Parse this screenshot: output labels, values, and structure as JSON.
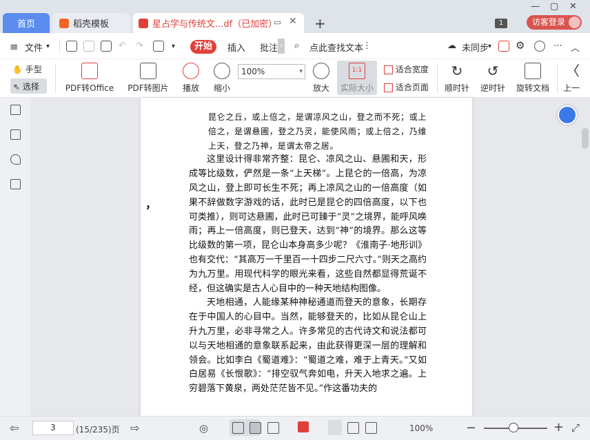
{
  "tabs": {
    "home": "首页",
    "template": "稻壳模板",
    "document": "星占学与传统文...df（已加密）"
  },
  "titlebar": {
    "page_badge": "1",
    "login": "访客登录"
  },
  "menu": {
    "file": "文件",
    "start": "开始",
    "insert": "插入",
    "annotate": "批注",
    "find_text": "点此查找文本",
    "sync": "未同步"
  },
  "ribbon": {
    "hand": "手型",
    "select": "选择",
    "pdf_to_office": "PDF转Office",
    "pdf_to_image": "PDF转图片",
    "play": "播放",
    "zoom_out": "缩小",
    "zoom_value": "100%",
    "zoom_in": "放大",
    "actual_size": "实际大小",
    "fit_width": "适合宽度",
    "fit_page": "适合页面",
    "rotate_cw": "顺时针",
    "rotate_ccw": "逆时针",
    "rotate_doc": "旋转文档",
    "prev": "上一"
  },
  "document": {
    "quote": "昆仑之丘，或上倍之，是谓凉风之山，登之而不死；或上倍之，是谓悬圃，登之乃灵，能使风雨；或上倍之，乃维上天，登之乃神，是谓太帝之居。",
    "paragraph1": "这里设计得非常齐整：昆仑、凉风之山、悬圃和天，形成等比级数，俨然是一条“上天梯”。上昆仑的一倍高，为凉风之山，登上即可长生不死；再上凉风之山的一倍高度（如果不辞做数字游戏的话，此时已是昆仑的四倍高度，以下也可类推），则可达悬圃，此时已可臻于“灵”之境界，能呼风唤雨；再上一倍高度，则已登天，达到“神”的境界。那么这等比级数的第一项，昆仑山本身高多少呢？《淮南子·地形训》也有交代：“其高万一千里百一十四步二尺六寸。”则天之高约为九万里。用现代科学的眼光来看，这些自然都显得荒诞不经，但这确实是古人心目中的一种天地结构图像。",
    "paragraph2": "天地相通，人能缘某种神秘通道而登天的意象，长期存在于中国人的心目中。当然，能够登天的，比如从昆仑山上升九万里，必非寻常之人。许多常见的古代诗文和说法都可以与天地相通的意象联系起来，由此获得更深一层的理解和领会。比如李白《蜀道难》：“蜀道之难，难于上青天。”又如白居易《长恨歌》：“排空驭气奔如电，升天入地求之遍。上穷碧落下黄泉，两处茫茫皆不见。”作这番功夫的",
    "stray_mark": "，"
  },
  "statusbar": {
    "page_number": "3",
    "page_info": "(15/235)页",
    "zoom_percent": "100%"
  }
}
